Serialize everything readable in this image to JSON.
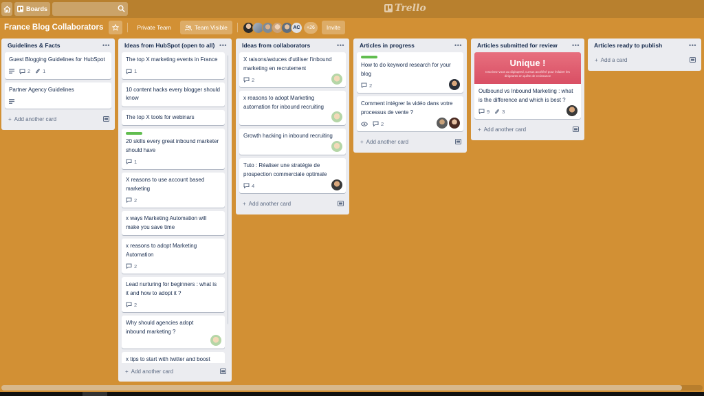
{
  "header": {
    "boards_label": "Boards",
    "search_placeholder": "",
    "logo_text": "Trello"
  },
  "board": {
    "title": "France Blog Collaborators",
    "team_label": "Private Team",
    "visibility_label": "Team Visible",
    "member_initials": "AC",
    "more_members": "+26",
    "invite_label": "Invite"
  },
  "add_card_label": "Add another card",
  "add_card_short": "Add a card",
  "lists": [
    {
      "title": "Guidelines & Facts",
      "cards": [
        {
          "title": "Guest Blogging Guidelines for HubSpot",
          "description": true,
          "comments": "2",
          "attachments": "1"
        },
        {
          "title": "Partner Agency Guidelines",
          "description": true
        }
      ]
    },
    {
      "title": "Ideas from HubSpot (open to all)",
      "cards": [
        {
          "title": "The top X marketing events in France",
          "comments": "1"
        },
        {
          "title": "10 content hacks every blogger should know"
        },
        {
          "title": "The top X tools for webinars"
        },
        {
          "title": "20 skills every great inbound marketer should have",
          "label": "green",
          "comments": "1"
        },
        {
          "title": "X reasons to use account based marketing",
          "comments": "2"
        },
        {
          "title": "x ways Marketing Automation will make you save time"
        },
        {
          "title": "x reasons to adopt Marketing Automation",
          "comments": "2"
        },
        {
          "title": "Lead nurturing for beginners : what is it and how to adopt it ?",
          "comments": "2"
        },
        {
          "title": "Why should agencies adopt inbound marketing ?",
          "member": "avatar-green"
        },
        {
          "title": "x tips to start with twitter and boost your account (organic and paid)"
        }
      ]
    },
    {
      "title": "Ideas from collaborators",
      "cards": [
        {
          "title": "X raisons/astuces d'utiliser l'inbound marketing en recrutement",
          "comments": "2",
          "member": "avatar-green"
        },
        {
          "title": "x reasons to adopt Marketing automation for inbound recruiting",
          "member": "avatar-green"
        },
        {
          "title": "Growth hacking in inbound recruiting",
          "member": "avatar-green"
        },
        {
          "title": "Tuto : Réaliser une stratégie de prospection commerciale optimale",
          "comments": "4",
          "member": "avatar-man"
        }
      ]
    },
    {
      "title": "Articles in progress",
      "cards": [
        {
          "title": "How to do keyword research for your blog",
          "label": "green",
          "comments": "2",
          "member": "avatar-dark"
        },
        {
          "title": "Comment intégrer la vidéo dans votre processus de vente ?",
          "watch": true,
          "comments": "2",
          "member": "avatar-pair"
        }
      ]
    },
    {
      "title": "Articles submitted for review",
      "cards": [
        {
          "title": "Outbound vs Inbound Marketing : what is the difference and which is best ?",
          "cover_title": "Unique !",
          "cover_sub": "Inscrivez-vous au digisqeed, cursus accéléré pour éclairer les dirigeants en quête de croissance",
          "comments": "9",
          "attachments": "3",
          "member": "avatar-man"
        }
      ]
    },
    {
      "title": "Articles ready to publish",
      "cards": []
    }
  ],
  "colors": {
    "board_bg": "#d29034",
    "label_green": "#61bd4f",
    "cover_pink": "#d94f64"
  }
}
